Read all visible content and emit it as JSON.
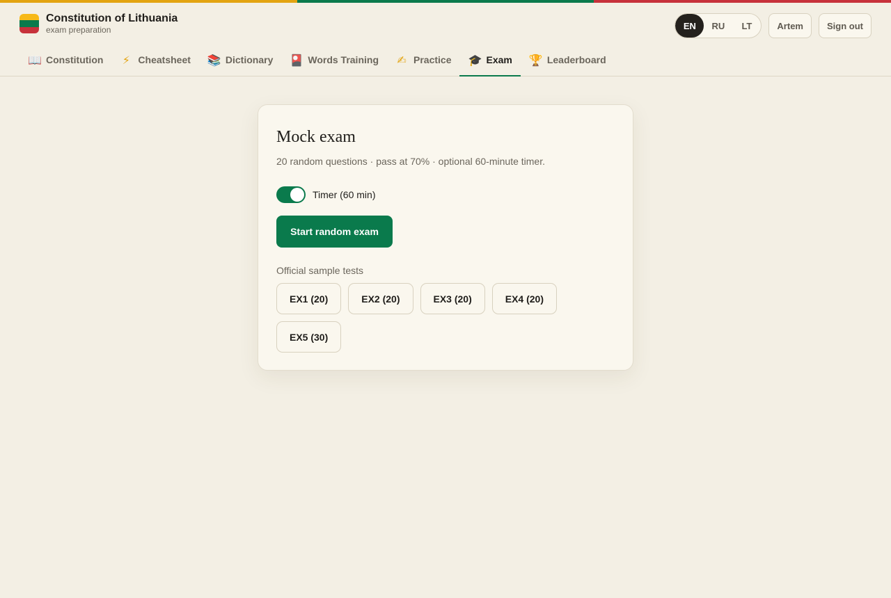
{
  "brand": {
    "title": "Constitution of Lithuania",
    "subtitle": "exam preparation",
    "flag_colors": [
      "#f7b917",
      "#0a7a4c",
      "#c7323b"
    ]
  },
  "header": {
    "languages": [
      {
        "label": "EN",
        "active": true
      },
      {
        "label": "RU",
        "active": false
      },
      {
        "label": "LT",
        "active": false
      }
    ],
    "user_label": "Artem",
    "signout_label": "Sign out"
  },
  "tabs": [
    {
      "label": "Constitution",
      "icon": "📖",
      "icon_name": "open-book-icon"
    },
    {
      "label": "Cheatsheet",
      "icon": "⚡",
      "icon_name": "lightning-icon"
    },
    {
      "label": "Dictionary",
      "icon": "📚",
      "icon_name": "books-icon"
    },
    {
      "label": "Words Training",
      "icon": "🎴",
      "icon_name": "cards-icon"
    },
    {
      "label": "Practice",
      "icon": "✍",
      "icon_name": "writing-hand-icon"
    },
    {
      "label": "Exam",
      "icon": "🎓",
      "icon_name": "graduation-cap-icon",
      "active": true
    },
    {
      "label": "Leaderboard",
      "icon": "🏆",
      "icon_name": "trophy-icon"
    }
  ],
  "exam": {
    "title": "Mock exam",
    "subtitle": "20 random questions · pass at 70% · optional 60-minute timer.",
    "timer_label": "Timer (60 min)",
    "timer_enabled": true,
    "start_label": "Start random exam",
    "samples_label": "Official sample tests",
    "samples": [
      "EX1 (20)",
      "EX2 (20)",
      "EX3 (20)",
      "EX4 (20)",
      "EX5 (30)"
    ]
  },
  "colors": {
    "accent": "#0a7a4c",
    "background": "#f3efe4",
    "card": "#faf7ee",
    "stripe_yellow": "#e3a411",
    "stripe_red": "#c7323b"
  }
}
